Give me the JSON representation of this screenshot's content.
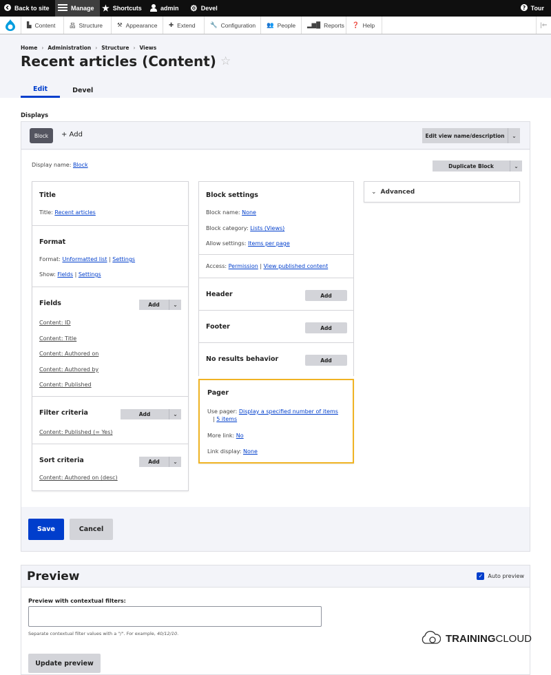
{
  "toolbar": {
    "back": "Back to site",
    "manage": "Manage",
    "shortcuts": "Shortcuts",
    "user": "admin",
    "devel": "Devel",
    "tour": "Tour"
  },
  "tray": {
    "items": [
      "Content",
      "Structure",
      "Appearance",
      "Extend",
      "Configuration",
      "People",
      "Reports",
      "Help"
    ]
  },
  "breadcrumb": [
    "Home",
    "Administration",
    "Structure",
    "Views"
  ],
  "page_title": "Recent articles (Content)",
  "tabs": [
    "Edit",
    "Devel"
  ],
  "displays": {
    "label": "Displays",
    "block_tab": "Block",
    "add_tab": "+ Add",
    "edit_view_btn": "Edit view name/description",
    "display_name_label": "Display name:",
    "display_name_value": "Block",
    "duplicate_btn": "Duplicate Block"
  },
  "left": {
    "title_sec": {
      "title": "Title",
      "label": "Title:",
      "value": "Recent articles"
    },
    "format_sec": {
      "title": "Format",
      "format_label": "Format:",
      "format_value": "Unformatted list",
      "format_settings": "Settings",
      "show_label": "Show:",
      "show_value": "Fields",
      "show_settings": "Settings"
    },
    "fields_sec": {
      "title": "Fields",
      "add": "Add",
      "items": [
        "Content: ID",
        "Content: Title",
        "Content: Authored on",
        "Content: Authored by",
        "Content: Published"
      ]
    },
    "filter_sec": {
      "title": "Filter criteria",
      "add": "Add",
      "items": [
        "Content: Published (= Yes)"
      ]
    },
    "sort_sec": {
      "title": "Sort criteria",
      "add": "Add",
      "items": [
        "Content: Authored on (desc)"
      ]
    }
  },
  "middle": {
    "block_settings": {
      "title": "Block settings",
      "name_label": "Block name:",
      "name_value": "None",
      "category_label": "Block category:",
      "category_value": "Lists (Views)",
      "allow_label": "Allow settings:",
      "allow_value": "Items per page"
    },
    "access": {
      "label": "Access:",
      "permission": "Permission",
      "view_published": "View published content"
    },
    "header": {
      "title": "Header",
      "add": "Add"
    },
    "footer": {
      "title": "Footer",
      "add": "Add"
    },
    "no_results": {
      "title": "No results behavior",
      "add": "Add"
    },
    "pager": {
      "title": "Pager",
      "use_label": "Use pager:",
      "use_value": "Display a specified number of items",
      "items_value": "5 items",
      "more_label": "More link:",
      "more_value": "No",
      "link_label": "Link display:",
      "link_value": "None"
    }
  },
  "right": {
    "advanced": "Advanced"
  },
  "actions": {
    "save": "Save",
    "cancel": "Cancel"
  },
  "preview": {
    "title": "Preview",
    "auto_preview": "Auto preview",
    "ctx_label": "Preview with contextual filters:",
    "ctx_value": "",
    "help_prefix": "Separate contextual filter values with a \"/\". For example, ",
    "help_example": "40/12/10",
    "help_suffix": ".",
    "update": "Update preview"
  },
  "watermark": {
    "brand_bold": "TRAINING",
    "brand_rest": "CLOUD"
  },
  "colors": {
    "accent": "#003ecc",
    "highlight": "#f0b323",
    "toolbar": "#0f0f0f"
  }
}
